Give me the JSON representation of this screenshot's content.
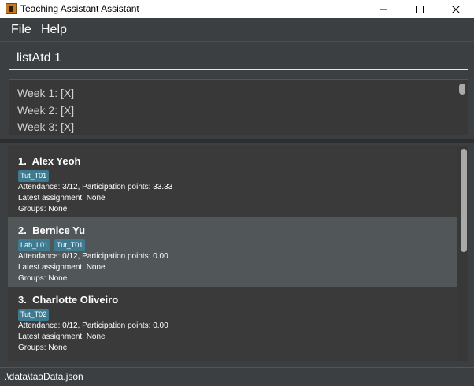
{
  "window": {
    "title": "Teaching Assistant Assistant"
  },
  "menu": {
    "items": [
      "File",
      "Help"
    ]
  },
  "command": {
    "value": "listAtd 1"
  },
  "result": {
    "lines": [
      "Week 1: [X]",
      "Week 2: [X]",
      "Week 3: [X]"
    ]
  },
  "students": [
    {
      "index": "1.",
      "name": "Alex Yeoh",
      "tags": [
        "Tut_T01"
      ],
      "attendance": "Attendance: 3/12, Participation points: 33.33",
      "assignment": "Latest assignment: None",
      "groups": "Groups: None"
    },
    {
      "index": "2.",
      "name": "Bernice Yu",
      "tags": [
        "Lab_L01",
        "Tut_T01"
      ],
      "attendance": "Attendance: 0/12, Participation points: 0.00",
      "assignment": "Latest assignment: None",
      "groups": "Groups: None"
    },
    {
      "index": "3.",
      "name": "Charlotte Oliveiro",
      "tags": [
        "Tut_T02"
      ],
      "attendance": "Attendance: 0/12, Participation points: 0.00",
      "assignment": "Latest assignment: None",
      "groups": "Groups: None"
    }
  ],
  "status": {
    "path": ".\\data\\taaData.json"
  },
  "colors": {
    "tag": "#3e7b91",
    "background": "#3c3f41",
    "selected_card": "#515658"
  }
}
